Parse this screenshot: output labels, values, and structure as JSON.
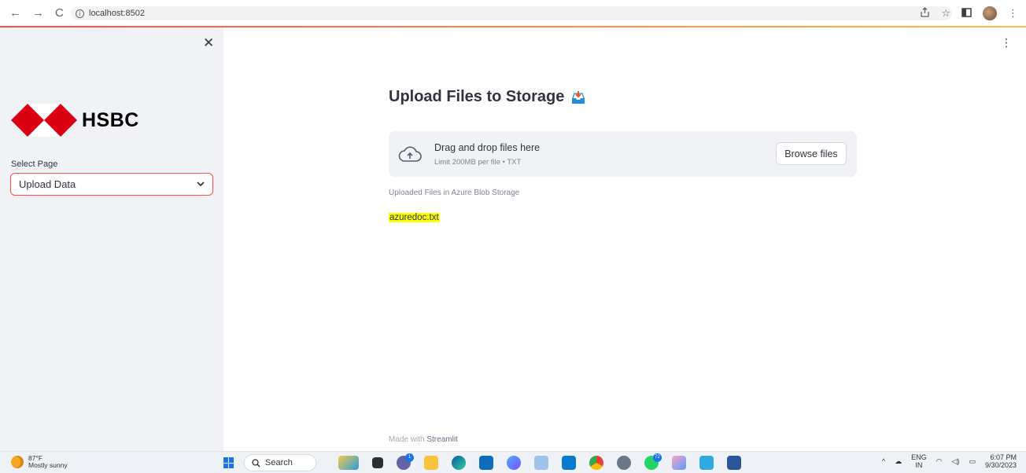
{
  "browser": {
    "url": "localhost:8502",
    "back_icon": "arrow-left-icon",
    "forward_icon": "arrow-right-icon",
    "reload_icon": "reload-icon"
  },
  "sidebar": {
    "close_icon": "close-icon",
    "logo_text": "HSBC",
    "select_label": "Select Page",
    "select_value": "Upload Data"
  },
  "main": {
    "title": "Upload Files to Storage",
    "title_icon": "inbox-tray-icon",
    "uploader": {
      "drop_title": "Drag and drop files here",
      "drop_limit": "Limit 200MB per file • TXT",
      "browse_label": "Browse files"
    },
    "files_caption": "Uploaded Files in Azure Blob Storage",
    "files": [
      "azuredoc.txt"
    ],
    "footer_prefix": "Made with",
    "footer_brand": "Streamlit"
  },
  "taskbar": {
    "weather_temp": "87°F",
    "weather_desc": "Mostly sunny",
    "search_label": "Search",
    "badge_mail": "1",
    "badge_whatsapp": "72",
    "lang_top": "ENG",
    "lang_bottom": "IN",
    "time": "6:07 PM",
    "date": "9/30/2023"
  },
  "colors": {
    "accent": "#ff4b4b",
    "sidebar_bg": "#f0f2f6",
    "highlight": "#ffff00",
    "hsbc_red": "#db0011"
  }
}
